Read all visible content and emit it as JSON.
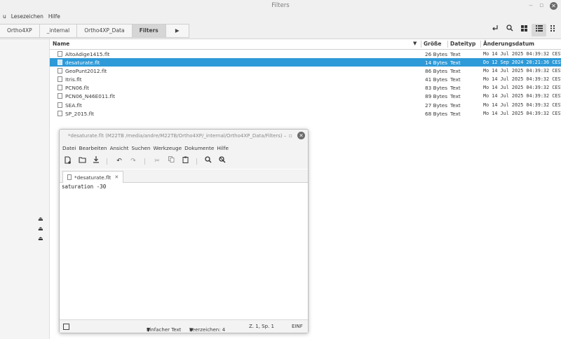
{
  "file_manager": {
    "title": "Filters",
    "window_controls": {
      "minimize": "‒",
      "maximize": "▫",
      "close": "✕"
    },
    "menu": [
      "u",
      "Lesezeichen",
      "Hilfe"
    ],
    "breadcrumbs": [
      "Ortho4XP",
      "_internal",
      "Ortho4XP_Data",
      "Filters"
    ],
    "breadcrumb_next": "▶",
    "toolbar_icons": [
      "new-folder-icon",
      "search-icon",
      "grid-view-icon",
      "list-view-icon",
      "compact-view-icon"
    ],
    "columns": {
      "name": "Name",
      "size": "Größe",
      "type": "Dateityp",
      "modified": "Änderungsdatum"
    },
    "sort_indicator": "▼",
    "files": [
      {
        "name": "AltoAdige1415.flt",
        "size": "26 Bytes",
        "type": "Text",
        "modified": "Mo 14 Jul 2025 04:39:32 CEST",
        "selected": false
      },
      {
        "name": "desaturate.flt",
        "size": "14 Bytes",
        "type": "Text",
        "modified": "Do 12 Sep 2024 20:21:36 CEST",
        "selected": true
      },
      {
        "name": "GeoPunt2012.flt",
        "size": "86 Bytes",
        "type": "Text",
        "modified": "Mo 14 Jul 2025 04:39:32 CEST",
        "selected": false
      },
      {
        "name": "Itris.flt",
        "size": "41 Bytes",
        "type": "Text",
        "modified": "Mo 14 Jul 2025 04:39:32 CEST",
        "selected": false
      },
      {
        "name": "PCN06.flt",
        "size": "83 Bytes",
        "type": "Text",
        "modified": "Mo 14 Jul 2025 04:39:32 CEST",
        "selected": false
      },
      {
        "name": "PCN06_N46E011.flt",
        "size": "89 Bytes",
        "type": "Text",
        "modified": "Mo 14 Jul 2025 04:39:32 CEST",
        "selected": false
      },
      {
        "name": "SEA.flt",
        "size": "27 Bytes",
        "type": "Text",
        "modified": "Mo 14 Jul 2025 04:39:32 CEST",
        "selected": false
      },
      {
        "name": "SP_2015.flt",
        "size": "68 Bytes",
        "type": "Text",
        "modified": "Mo 14 Jul 2025 04:39:32 CEST",
        "selected": false
      }
    ],
    "sidebar_eject_icons": [
      "⏏",
      "⏏",
      "⏏"
    ]
  },
  "editor": {
    "title": "*desaturate.flt (M22TB /media/andre/M22TB/Ortho4XP/_internal/Ortho4XP_Data/Filters) –",
    "menu": [
      "Datei",
      "Bearbeiten",
      "Ansicht",
      "Suchen",
      "Werkzeuge",
      "Dokumente",
      "Hilfe"
    ],
    "tab_label": "*desaturate.flt",
    "tab_close": "✕",
    "content": "saturation -30",
    "status": {
      "syntax": "Einfacher Text",
      "spaces": "Leerzeichen: 4",
      "position": "Z. 1, Sp. 1",
      "mode": "EINF",
      "dropdown": "▼"
    }
  },
  "colors": {
    "selection": "#2e9ad8",
    "window_bg": "#f0f0f0",
    "close_button": "#6c6c6c"
  }
}
